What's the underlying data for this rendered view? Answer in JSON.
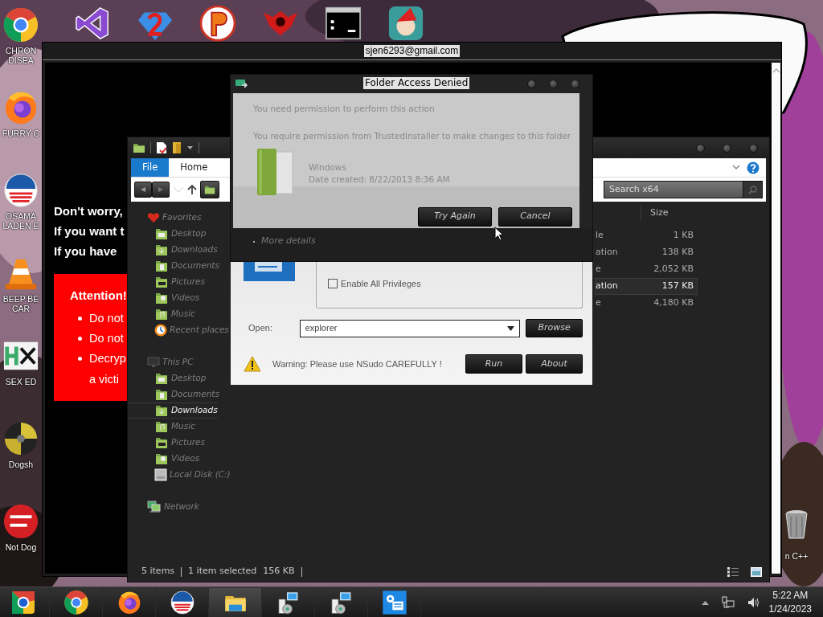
{
  "desktop": {
    "left_icons": [
      {
        "kind": "browser",
        "label": [
          "CHRON",
          "DISEA"
        ]
      },
      {
        "kind": "globe",
        "label": [
          "FURRY C"
        ]
      },
      {
        "kind": "striped",
        "label": [
          "OSAMA",
          "LADEN E"
        ]
      },
      {
        "kind": "cone",
        "label": [
          "BEEP BE",
          "CAR"
        ]
      },
      {
        "kind": "xlogo",
        "label": [
          "SEX ED"
        ]
      },
      {
        "kind": "disc",
        "label": [
          "Dogsh"
        ]
      },
      {
        "kind": "redcircle",
        "label": [
          "Not Dog"
        ]
      }
    ],
    "top_icons": [
      {
        "kind": "ribbon"
      },
      {
        "kind": "gem"
      },
      {
        "kind": "badge"
      },
      {
        "kind": "shield"
      },
      {
        "kind": "terminal"
      },
      {
        "kind": "round"
      }
    ],
    "recycle_label": "n C++"
  },
  "ransom_window": {
    "title": "sjen6293@gmail.com",
    "lines": [
      "Don't worry,",
      "If you want t",
      "If you have"
    ],
    "notice": {
      "heading": "Attention!",
      "bullets": [
        "Do not",
        "Do not",
        "Decryp"
      ],
      "continuation": "a victi"
    }
  },
  "explorer": {
    "ribbon_tabs": [
      {
        "label": "File",
        "selected": true
      },
      {
        "label": "Home",
        "selected": false
      }
    ],
    "search": {
      "placeholder": "Search x64"
    },
    "nav": [
      {
        "kind": "favorites",
        "label": "Favorites",
        "selected": false,
        "children": [
          {
            "kind": "desktop",
            "label": "Desktop",
            "selected": false
          },
          {
            "kind": "downloads",
            "label": "Downloads",
            "selected": false
          },
          {
            "kind": "documents",
            "label": "Documents",
            "selected": false
          },
          {
            "kind": "pictures",
            "label": "Pictures",
            "selected": false
          },
          {
            "kind": "videos",
            "label": "Videos",
            "selected": false
          },
          {
            "kind": "music",
            "label": "Music",
            "selected": false
          },
          {
            "kind": "recent",
            "label": "Recent places",
            "selected": false
          }
        ]
      },
      {
        "kind": "pc",
        "label": "This PC",
        "selected": false,
        "children": [
          {
            "kind": "desktop",
            "label": "Desktop",
            "selected": false
          },
          {
            "kind": "documents",
            "label": "Documents",
            "selected": false
          },
          {
            "kind": "downloads",
            "label": "Downloads",
            "selected": true
          },
          {
            "kind": "music",
            "label": "Music",
            "selected": false
          },
          {
            "kind": "pictures",
            "label": "Pictures",
            "selected": false
          },
          {
            "kind": "videos",
            "label": "Videos",
            "selected": false
          },
          {
            "kind": "disk",
            "label": "Local Disk (C:)",
            "selected": false
          }
        ]
      },
      {
        "kind": "network",
        "label": "Network",
        "selected": false
      }
    ],
    "table": {
      "columns": [
        {
          "label": "Size"
        }
      ],
      "rows": [
        {
          "column_1": "le",
          "size": "1 KB",
          "selected": false
        },
        {
          "column_1": "ation",
          "size": "138 KB",
          "selected": false
        },
        {
          "column_1": "e",
          "size": "2,052 KB",
          "selected": false
        },
        {
          "column_1": "ation",
          "size": "157 KB",
          "selected": true
        },
        {
          "column_1": "e",
          "size": "4,180 KB",
          "selected": false
        }
      ]
    },
    "status_bar": {
      "items": "5 items",
      "selection": "1 item selected",
      "size": "156 KB"
    }
  },
  "nsudo": {
    "checkbox": {
      "label": "Enable All Privileges",
      "checked": false
    },
    "open_label": "Open:",
    "open_value": "explorer",
    "browse": "Browse",
    "warning": "Warning: Please use NSudo CAREFULLY !",
    "buttons": [
      "Run",
      "About"
    ]
  },
  "dialog": {
    "title": "Folder Access Denied",
    "message": "You need permission to perform this action",
    "detail": "You require permission from TrustedInstaller to make changes to this folder",
    "item": {
      "name": "Windows",
      "date": "Date created: 8/22/2013 8:36 AM"
    },
    "buttons": [
      "Try Again",
      "Cancel"
    ],
    "more": "More details"
  },
  "taskbar": {
    "apps": [
      {
        "kind": "browser2",
        "active": false
      },
      {
        "kind": "browser",
        "active": false
      },
      {
        "kind": "globe",
        "active": false
      },
      {
        "kind": "striped",
        "active": false
      },
      {
        "kind": "folder",
        "active": true
      },
      {
        "kind": "installer",
        "active": false
      },
      {
        "kind": "installer",
        "active": false
      },
      {
        "kind": "settings",
        "active": false
      }
    ],
    "clock": {
      "time": "5:22 AM",
      "date": "1/24/2023"
    }
  }
}
